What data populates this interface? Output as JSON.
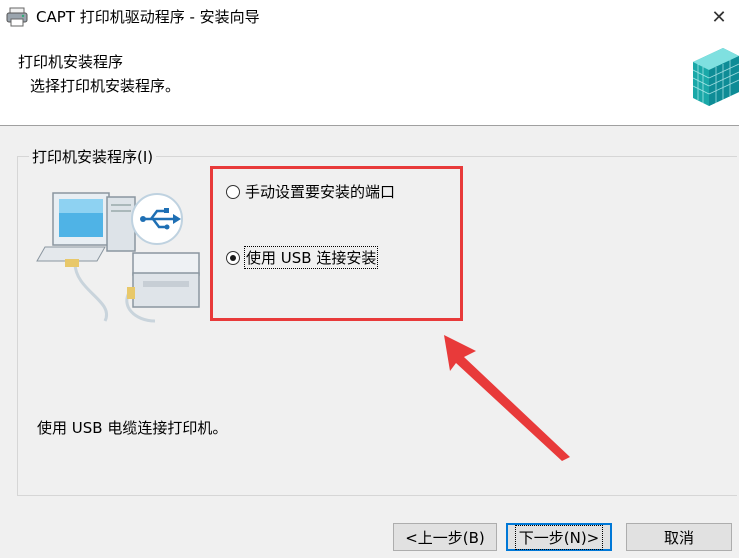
{
  "window": {
    "title": "CAPT 打印机驱动程序 - 安装向导",
    "close_glyph": "✕"
  },
  "header": {
    "title": "打印机安装程序",
    "subtitle": "选择打印机安装程序。"
  },
  "group": {
    "legend": "打印机安装程序(I)",
    "options": [
      {
        "label": "手动设置要安装的端口",
        "checked": false
      },
      {
        "label": "使用 USB 连接安装",
        "checked": true
      }
    ],
    "description": "使用 USB 电缆连接打印机。"
  },
  "buttons": {
    "back": "<上一步(B)",
    "next": "下一步(N)>",
    "cancel": "取消"
  },
  "colors": {
    "annotation_red": "#e83a3a",
    "focus_blue": "#0078d7",
    "dialog_bg": "#f0f0f0"
  }
}
